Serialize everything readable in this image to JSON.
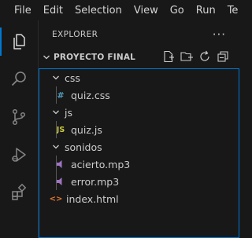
{
  "menu": [
    "File",
    "Edit",
    "Selection",
    "View",
    "Go",
    "Run",
    "Te"
  ],
  "sidebar": {
    "title": "EXPLORER",
    "more": "···"
  },
  "section": {
    "title": "PROYECTO FINAL"
  },
  "tree": {
    "css": {
      "label": "css",
      "files": {
        "quiz_css": "quiz.css"
      }
    },
    "js": {
      "label": "js",
      "files": {
        "quiz_js": "quiz.js"
      }
    },
    "sonidos": {
      "label": "sonidos",
      "files": {
        "acierto": "acierto.mp3",
        "error": "error.mp3"
      }
    },
    "index": "index.html"
  },
  "icons": {
    "css_glyph": "#",
    "js_glyph": "JS",
    "html_glyph": "<>"
  },
  "colors": {
    "accent": "#0078d4",
    "logo": "#3ea6f2",
    "css_icon": "#519aba",
    "js_icon": "#cbcb41",
    "audio_icon": "#a074c4",
    "html_icon": "#e37933"
  }
}
